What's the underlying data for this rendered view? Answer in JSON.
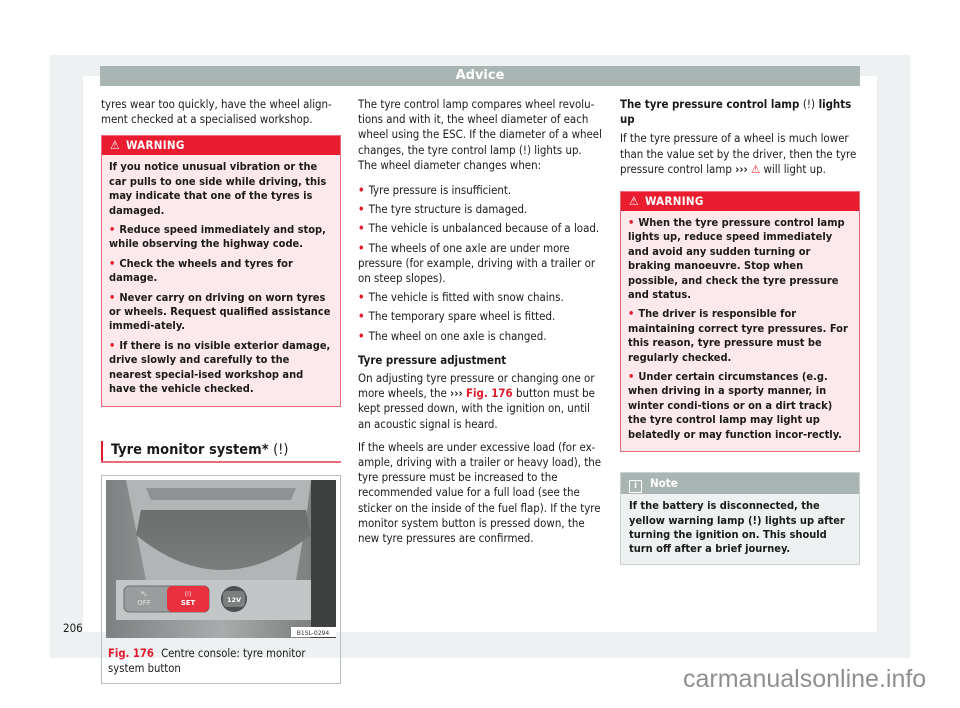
{
  "header": {
    "title": "Advice"
  },
  "col1": {
    "intro": "tyres wear too quickly, have the wheel align-ment checked at a specialised workshop.",
    "warning": {
      "icon": "warning-triangle-icon",
      "title": "WARNING",
      "lead": "If you notice unusual vibration or the car pulls to one side while driving, this may indicate that one of the tyres is damaged.",
      "bullets": [
        "Reduce speed immediately and stop, while observing the highway code.",
        "Check the wheels and tyres for damage.",
        "Never carry on driving on worn tyres or wheels. Request qualified assistance immedi-ately.",
        "If there is no visible exterior damage, drive slowly and carefully to the nearest special-ised workshop and have the vehicle checked."
      ]
    },
    "section_title": "Tyre monitor system*",
    "section_lamp": "(!)",
    "figure": {
      "code": "B1SL-0294",
      "buttons": {
        "off": "OFF",
        "set": "SET",
        "socket": "12V"
      },
      "caption_num": "Fig. 176",
      "caption_text": "Centre console: tyre monitor system button"
    }
  },
  "col2": {
    "intro": "The tyre control lamp compares wheel revolu-tions and with it, the wheel diameter of each wheel using the ESC. If the diameter of a wheel changes, the tyre control lamp (!) lights up. The wheel diameter changes when:",
    "bullets": [
      "Tyre pressure is insufficient.",
      "The tyre structure is damaged.",
      "The vehicle is unbalanced because of a load.",
      "The wheels of one axle are under more pressure (for example, driving with a trailer or on steep slopes).",
      "The vehicle is fitted with snow chains.",
      "The temporary spare wheel is fitted.",
      "The wheel on one axle is changed."
    ],
    "subheading": "Tyre pressure adjustment",
    "adjust_pre": "On adjusting tyre pressure or changing one or more wheels, the",
    "adjust_arrows": "›››",
    "adjust_link": "Fig. 176",
    "adjust_post": "button must be kept pressed down, with the ignition on, until an acoustic signal is heard.",
    "load_para": "If the wheels are under excessive load (for ex-ample, driving with a trailer or heavy load), the tyre pressure must be increased to the recommended value for a full load (see the sticker on the inside of the fuel flap). If the tyre monitor system button is pressed down, the new tyre pressures are confirmed."
  },
  "col3": {
    "heading_pre": "The tyre pressure control lamp",
    "heading_lamp": "(!)",
    "heading_post": "lights up",
    "para_pre": "If the tyre pressure of a wheel is much lower than the value set by the driver, then the tyre pressure control lamp",
    "para_arrows": "›››",
    "para_post": "will light up.",
    "warning": {
      "title": "WARNING",
      "bullets": [
        "When the tyre pressure control lamp lights up, reduce speed immediately and avoid any sudden turning or braking manoeuvre. Stop when possible, and check the tyre pressure and status.",
        "The driver is responsible for maintaining correct tyre pressures. For this reason, tyre pressure must be regularly checked.",
        "Under certain circumstances (e.g. when driving in a sporty manner, in winter condi-tions or on a dirt track) the tyre control lamp may light up belatedly or may function incor-rectly."
      ]
    },
    "note": {
      "icon": "info-icon",
      "title": "Note",
      "text": "If the battery is disconnected, the yellow warning lamp (!) lights up after turning the ignition on. This should turn off after a brief journey."
    }
  },
  "footer": {
    "page_number": "206",
    "watermark": "carmanualsonline.info"
  },
  "colors": {
    "accent_red": "#e3192c",
    "header_gray": "#a8b5b3",
    "warning_bg": "#fde9ec",
    "note_bg": "#eef1f2"
  }
}
